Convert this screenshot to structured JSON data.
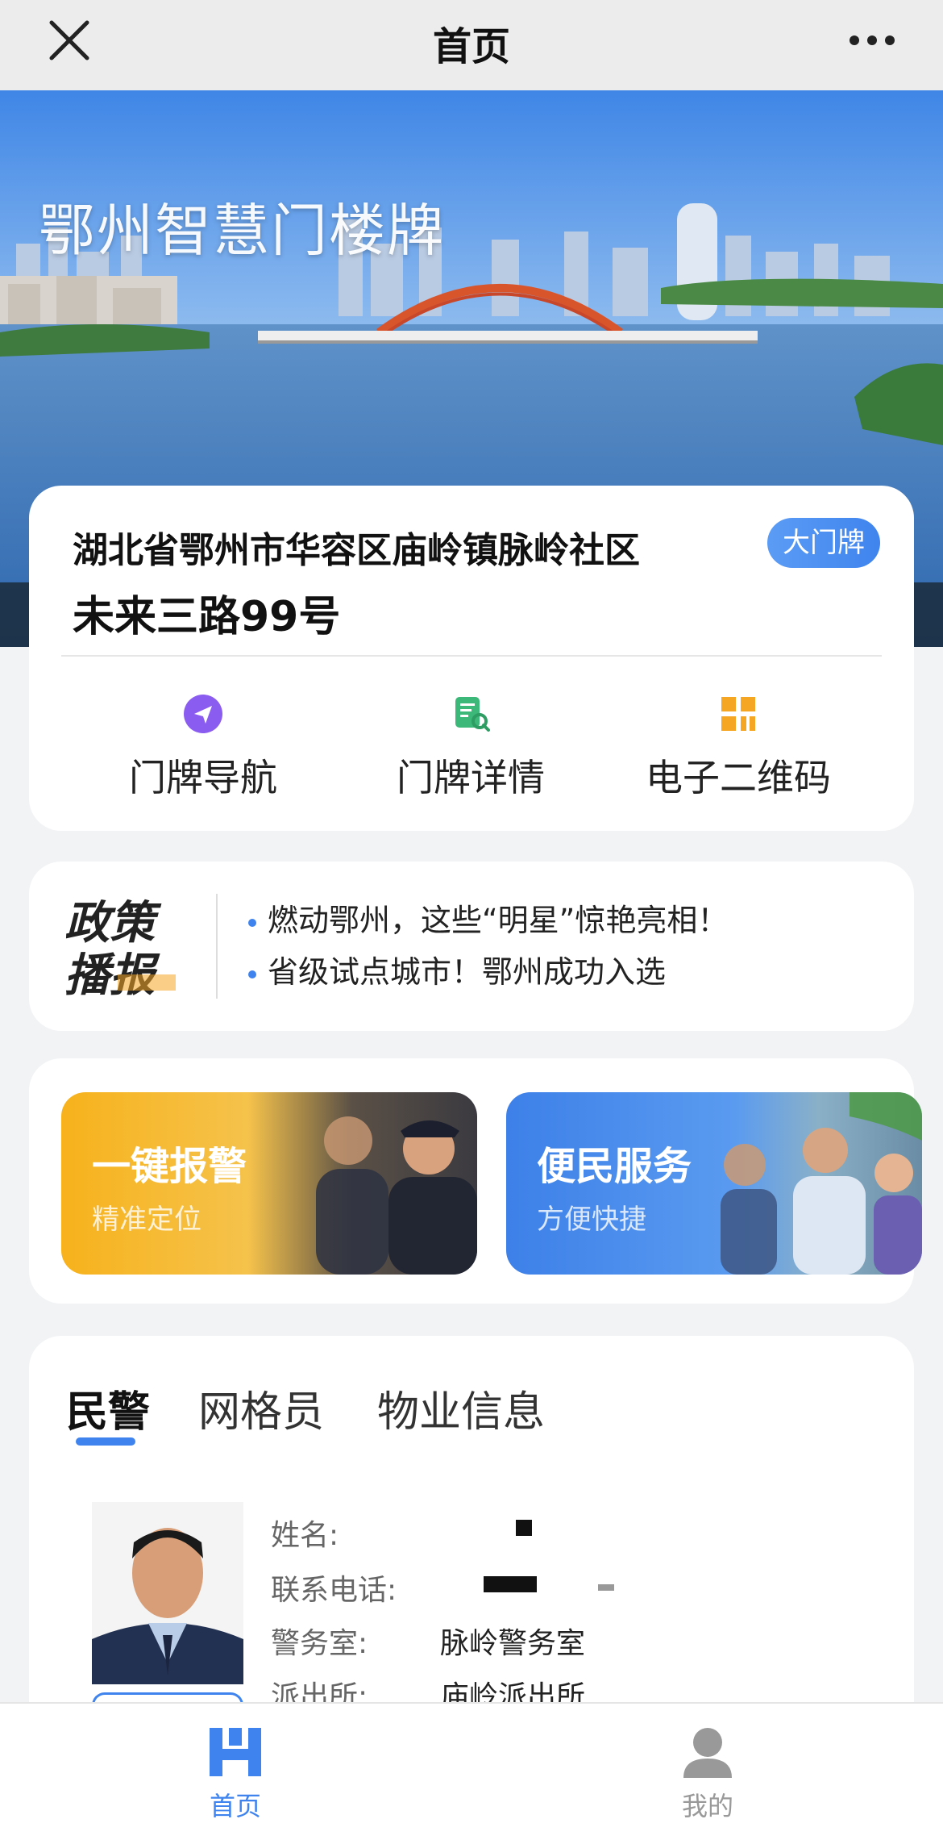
{
  "nav": {
    "title": "首页"
  },
  "hero": {
    "title": "鄂州智慧门楼牌"
  },
  "address": {
    "line1": "湖北省鄂州市华容区庙岭镇脉岭社区",
    "line2": "未来三路99号",
    "badge": "大门牌",
    "actions": [
      {
        "label": "门牌导航",
        "icon": "navigation-icon"
      },
      {
        "label": "门牌详情",
        "icon": "document-search-icon"
      },
      {
        "label": "电子二维码",
        "icon": "qrcode-grid-icon"
      }
    ]
  },
  "policy": {
    "logo_text": [
      "政策",
      "播报"
    ],
    "items": [
      "燃动鄂州，这些“明星”惊艳亮相！",
      "省级试点城市！鄂州成功入选"
    ]
  },
  "services": [
    {
      "title": "一键报警",
      "subtitle": "精准定位"
    },
    {
      "title": "便民服务",
      "subtitle": "方便快捷"
    }
  ],
  "info": {
    "tabs": [
      "民警",
      "网格员",
      "物业信息"
    ],
    "active_tab": 0,
    "fields": [
      {
        "label": "姓名:",
        "value": ""
      },
      {
        "label": "联系电话:",
        "value": ""
      },
      {
        "label": "警务室:",
        "value": "脉岭警务室"
      },
      {
        "label": "派出所:",
        "value": "庙岭派出所"
      }
    ]
  },
  "tabbar": {
    "items": [
      {
        "label": "首页",
        "icon": "home-icon",
        "active": true
      },
      {
        "label": "我的",
        "icon": "user-icon",
        "active": false
      }
    ],
    "active_color": "#3f84ee",
    "inactive_color": "#999999"
  }
}
